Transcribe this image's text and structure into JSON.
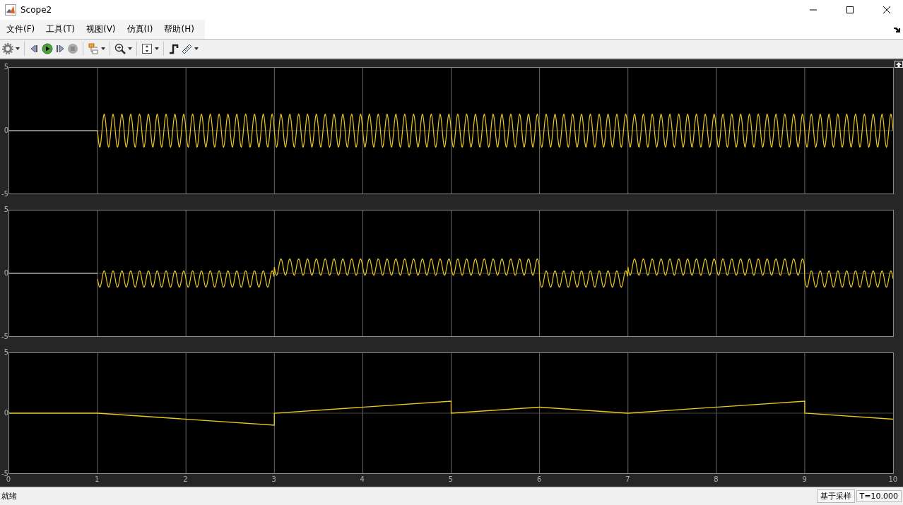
{
  "window": {
    "title": "Scope2"
  },
  "menu": [
    {
      "label": "文件(F)"
    },
    {
      "label": "工具(T)"
    },
    {
      "label": "视图(V)"
    },
    {
      "label": "仿真(I)"
    },
    {
      "label": "帮助(H)"
    }
  ],
  "axes": [
    {
      "kind": "steady-wave",
      "yticks": [
        "5",
        "0",
        "-5"
      ]
    },
    {
      "kind": "switching-wave",
      "yticks": [
        "5",
        "0",
        "-5"
      ]
    },
    {
      "kind": "chart",
      "chart_data": {
        "type": "line",
        "x": [
          0,
          1,
          3,
          3,
          5,
          5,
          6,
          7,
          9,
          9,
          10
        ],
        "series": [
          {
            "color": "#e8c81c",
            "values": [
              0,
              0,
              -1,
              0,
              1,
              0,
              0.5,
              0,
              1,
              0,
              -0.5
            ]
          }
        ],
        "xlim": [
          0,
          10
        ],
        "ylim": [
          -5,
          5
        ],
        "xticks": [
          0,
          1,
          2,
          3,
          4,
          5,
          6,
          7,
          8,
          9,
          10
        ],
        "yticks": [
          -5,
          0,
          5
        ],
        "grid": true
      }
    }
  ],
  "status": {
    "text": "就绪",
    "mode": "基于采样",
    "time": "T=10.000"
  }
}
